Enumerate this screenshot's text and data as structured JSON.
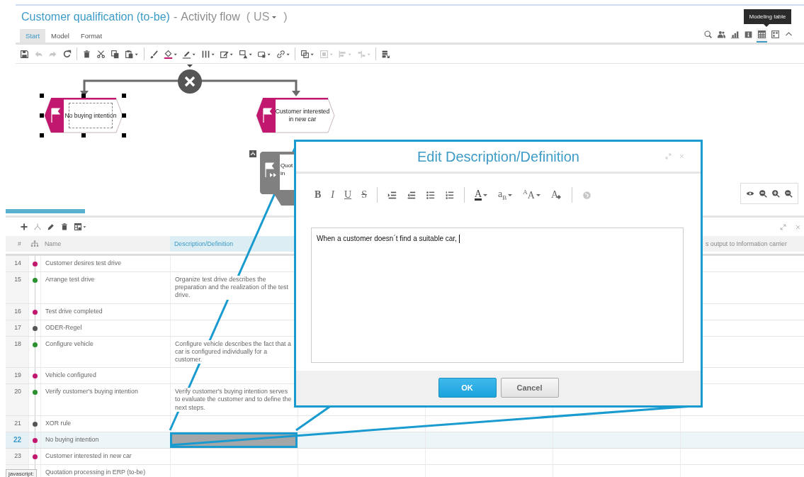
{
  "title": {
    "name": "Customer qualification (to-be)",
    "separator": "-",
    "model_type": "Activity flow",
    "language_open": "(",
    "language": "US",
    "language_close": ")"
  },
  "ribbon_tabs": [
    {
      "label": "Start",
      "selected": true
    },
    {
      "label": "Model",
      "selected": false
    },
    {
      "label": "Format",
      "selected": false
    }
  ],
  "view_buttons": [
    {
      "kind": "search",
      "selected": false
    },
    {
      "kind": "people",
      "selected": false
    },
    {
      "kind": "barchart",
      "selected": false
    },
    {
      "kind": "info",
      "selected": false
    },
    {
      "kind": "table",
      "selected": true
    },
    {
      "kind": "layout",
      "selected": false
    },
    {
      "kind": "caretup",
      "selected": false
    }
  ],
  "tooltip": "Modeling table",
  "toolbar": [
    {
      "kind": "save",
      "disabled": false,
      "dropdown": false
    },
    {
      "kind": "undo",
      "disabled": true,
      "dropdown": false
    },
    {
      "kind": "redo",
      "disabled": true,
      "dropdown": false
    },
    {
      "kind": "refresh",
      "disabled": false,
      "dropdown": false
    },
    {
      "kind": "separator"
    },
    {
      "kind": "trash",
      "disabled": false,
      "dropdown": false
    },
    {
      "kind": "scissors",
      "disabled": false,
      "dropdown": false
    },
    {
      "kind": "copy",
      "disabled": false,
      "dropdown": false
    },
    {
      "kind": "paste",
      "disabled": false,
      "dropdown": true
    },
    {
      "kind": "separator"
    },
    {
      "kind": "brush",
      "disabled": false,
      "dropdown": false
    },
    {
      "kind": "fill",
      "disabled": false,
      "dropdown": true
    },
    {
      "kind": "linecolor",
      "disabled": false,
      "dropdown": true
    },
    {
      "kind": "columns",
      "disabled": false,
      "dropdown": true
    },
    {
      "kind": "editbox",
      "disabled": false,
      "dropdown": true
    },
    {
      "kind": "shapes",
      "disabled": false,
      "dropdown": true
    },
    {
      "kind": "rectshape",
      "disabled": false,
      "dropdown": true
    },
    {
      "kind": "link",
      "disabled": false,
      "dropdown": true
    },
    {
      "kind": "separator"
    },
    {
      "kind": "arrange",
      "disabled": false,
      "dropdown": true
    },
    {
      "kind": "group",
      "disabled": true,
      "dropdown": true
    },
    {
      "kind": "align",
      "disabled": true,
      "dropdown": true
    },
    {
      "kind": "distribute",
      "disabled": true,
      "dropdown": true
    },
    {
      "kind": "separator"
    },
    {
      "kind": "exporttable",
      "disabled": false,
      "dropdown": false
    }
  ],
  "diagram": {
    "nodes": [
      {
        "kind": "event",
        "lines": [
          "No buying intention"
        ],
        "selected": true
      },
      {
        "kind": "event",
        "lines": [
          "Customer interested",
          "in new car"
        ],
        "selected": false
      },
      {
        "kind": "interface",
        "lines": [
          "Quot",
          "in"
        ],
        "selected": false
      }
    ],
    "gate": {
      "kind": "xor"
    },
    "controls": [
      {
        "kind": "eye"
      },
      {
        "kind": "zoomreset"
      },
      {
        "kind": "zoomin"
      },
      {
        "kind": "zoomout"
      }
    ]
  },
  "table": {
    "toolbar": [
      {
        "kind": "plus",
        "dropdown": false
      },
      {
        "kind": "tree",
        "dropdown": false
      },
      {
        "kind": "pencil",
        "dropdown": false
      },
      {
        "kind": "trash",
        "dropdown": false
      },
      {
        "kind": "tablesettings",
        "dropdown": true
      }
    ],
    "pane_controls": [
      {
        "kind": "expand"
      },
      {
        "kind": "close"
      }
    ],
    "columns": [
      {
        "label": "#",
        "selected": false
      },
      {
        "label": "Name",
        "selected": false
      },
      {
        "label": "Description/Definition",
        "selected": true
      },
      {
        "label": "s output to Information carrier",
        "selected": false
      }
    ],
    "rows": [
      {
        "number": "14",
        "name": "Customer desires test drive",
        "color": "#c2176e",
        "selected": false,
        "editing": false
      },
      {
        "number": "15",
        "name": "Arrange test drive",
        "description": "Organize test drive describes the preparation and the realization of the test drive.",
        "color": "#2a9030",
        "selected": false,
        "editing": false
      },
      {
        "number": "16",
        "name": "Test drive completed",
        "color": "#c2176e",
        "selected": false,
        "editing": false
      },
      {
        "number": "17",
        "name": "ODER-Regel",
        "color": "#555555",
        "selected": false,
        "editing": false
      },
      {
        "number": "18",
        "name": "Configure vehicle",
        "description": "Configure vehicle describes the fact that a car is configured individually for a customer.",
        "color": "#2a9030",
        "selected": false,
        "editing": false
      },
      {
        "number": "19",
        "name": "Vehicle configured",
        "color": "#c2176e",
        "selected": false,
        "editing": false
      },
      {
        "number": "20",
        "name": "Verify customer's buying intention",
        "description": "Verify customer's buying intention serves to evaluate the customer and to define the next steps.",
        "color": "#2a9030",
        "selected": false,
        "editing": false
      },
      {
        "number": "21",
        "name": "XOR rule",
        "color": "#555555",
        "selected": false,
        "editing": false
      },
      {
        "number": "22",
        "name": "No buying intention",
        "color": "#c2176e",
        "selected": true,
        "editing": true
      },
      {
        "number": "23",
        "name": "Customer interested in new car",
        "color": "#c2176e",
        "selected": false,
        "editing": false
      },
      {
        "name": "Quotation processing in ERP (to-be)",
        "selected": false,
        "editing": false
      }
    ]
  },
  "dialog": {
    "title": "Edit Description/Definition",
    "header_controls": [
      {
        "kind": "expand"
      },
      {
        "kind": "close"
      }
    ],
    "toolbar": [
      {
        "kind": "bold",
        "label": "B",
        "disabled": false
      },
      {
        "kind": "italic",
        "label": "I",
        "disabled": false
      },
      {
        "kind": "underline",
        "label": "U",
        "disabled": false
      },
      {
        "kind": "strike",
        "label": "S",
        "disabled": false
      },
      {
        "kind": "separator"
      },
      {
        "kind": "indent",
        "disabled": false
      },
      {
        "kind": "outdent",
        "disabled": false
      },
      {
        "kind": "bulletlist",
        "disabled": false
      },
      {
        "kind": "numberedlist",
        "disabled": false
      },
      {
        "kind": "separator"
      },
      {
        "kind": "fontcolor",
        "label": "A",
        "disabled": false
      },
      {
        "kind": "script",
        "label": "a$_{B}$",
        "disabled": false
      },
      {
        "kind": "fontsize",
        "label": "$^{A}$A",
        "disabled": false
      },
      {
        "kind": "eraser",
        "label": "A",
        "disabled": false
      },
      {
        "kind": "separator"
      },
      {
        "kind": "globe",
        "disabled": true
      }
    ],
    "value": "When a customer doesn´t find a suitable car, ",
    "buttons": [
      {
        "label": "OK",
        "primary": true
      },
      {
        "label": "Cancel",
        "primary": false
      }
    ]
  },
  "status_tip": "javascript:"
}
